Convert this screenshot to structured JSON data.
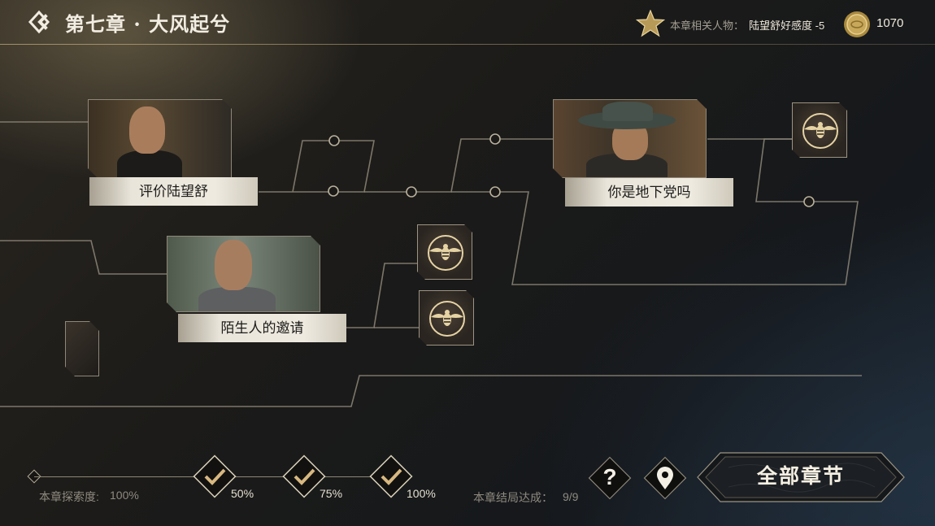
{
  "header": {
    "chapter_title": "第七章 · 大风起兮",
    "related_label": "本章相关人物：",
    "related_value": "陆望舒好感度 -5",
    "coin_count": "1070"
  },
  "nodes": [
    {
      "caption": "评价陆望舒"
    },
    {
      "caption": "陌生人的邀请"
    },
    {
      "caption": "你是地下党吗"
    }
  ],
  "progress": {
    "explore_label": "本章探索度:",
    "explore_value": "100%",
    "milestones": [
      "50%",
      "75%",
      "100%"
    ],
    "ending_label": "本章结局达成：",
    "ending_value": "9/9"
  },
  "buttons": {
    "help": "?",
    "all_chapters": "全部章节"
  },
  "colors": {
    "accent_gold": "#c9b383",
    "caption_bg": "#eeeae0"
  }
}
